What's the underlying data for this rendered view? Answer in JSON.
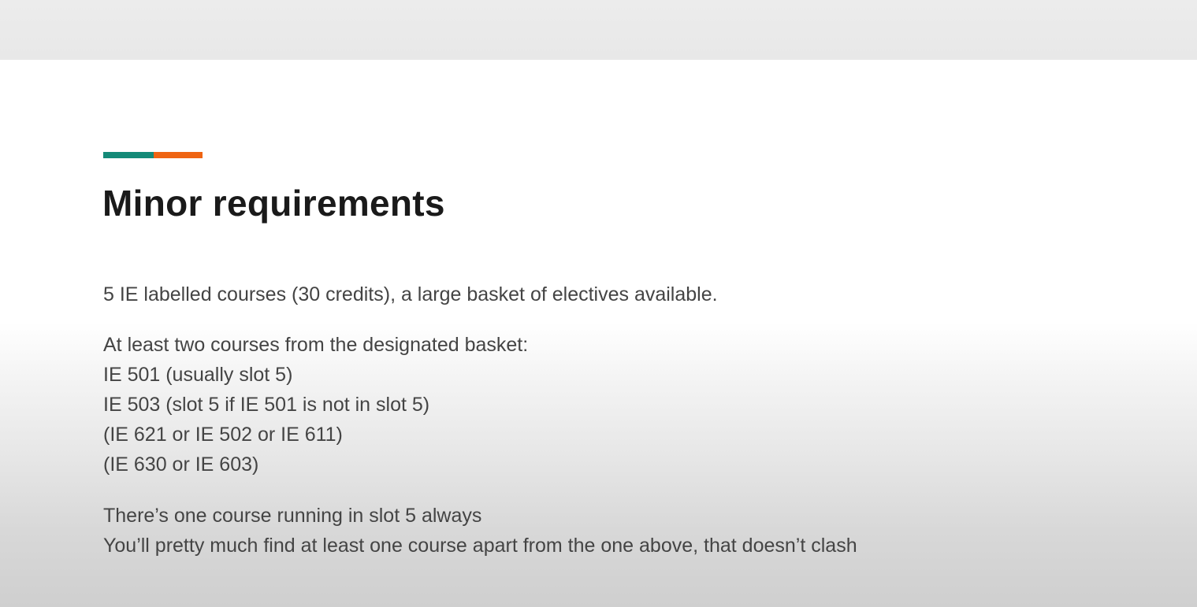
{
  "slide": {
    "title": "Minor requirements",
    "accent_colors": {
      "teal": "#148a78",
      "orange": "#ef6412"
    },
    "paragraph1": "5 IE labelled courses (30 credits), a large basket of electives available.",
    "paragraph2": [
      "At least two courses from the designated basket:",
      "IE 501 (usually slot 5)",
      "IE 503 (slot 5 if IE 501 is not in slot 5)",
      "(IE 621 or IE 502 or IE 611)",
      "(IE 630 or IE 603)"
    ],
    "paragraph3": [
      "There’s one course running in slot 5 always",
      "You’ll pretty much find at least one course apart from the one above, that doesn’t clash"
    ]
  }
}
